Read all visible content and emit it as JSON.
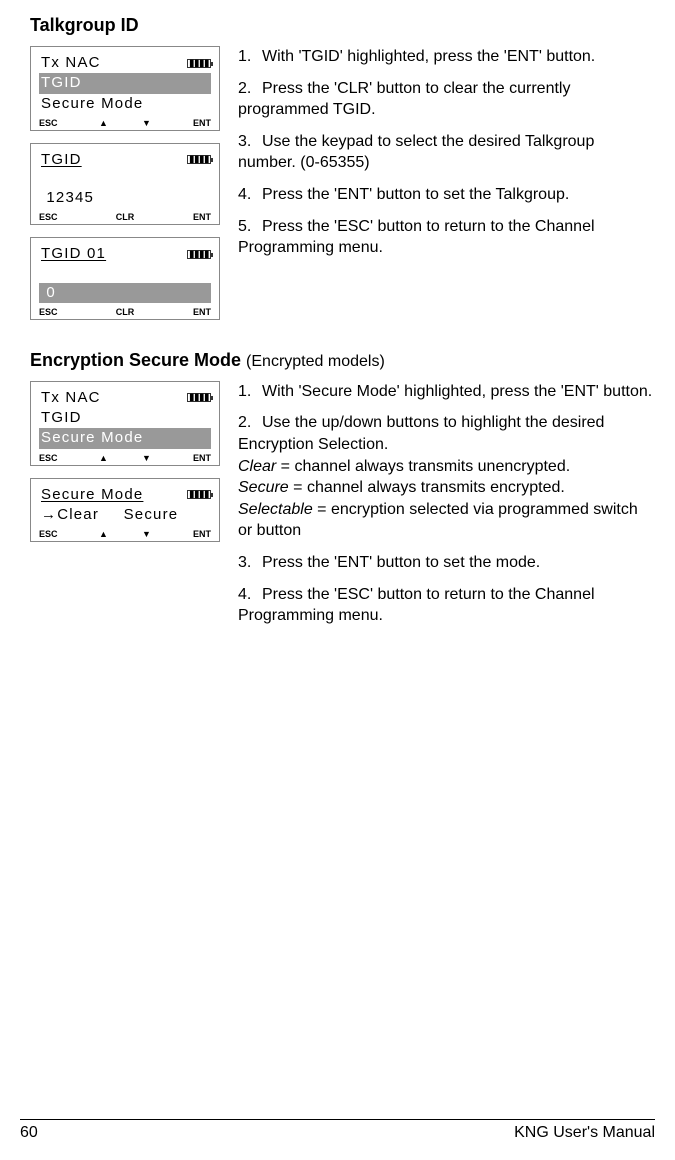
{
  "section1": {
    "heading": "Talkgroup ID",
    "screen1": {
      "line1": "Tx NAC",
      "line2": "TGID",
      "line3": "Secure Mode",
      "sk1": "ESC",
      "sk2": "▲",
      "sk3": "▼",
      "sk4": "ENT"
    },
    "screen2": {
      "line1": "TGID",
      "line2": " 12345",
      "sk1": "ESC",
      "sk2": "CLR",
      "sk3": "ENT"
    },
    "screen3": {
      "line1": "TGID 01",
      "line2": " 0",
      "sk1": "ESC",
      "sk2": "CLR",
      "sk3": "ENT"
    },
    "steps": {
      "s1": "With 'TGID' highlighted, press the 'ENT' button.",
      "s2": "Press the 'CLR' button to clear the currently programmed TGID.",
      "s3": "Use the keypad to select the desired Talkgroup number. (0-65355)",
      "s4": "Press the 'ENT' button to set the Talkgroup.",
      "s5": "Press the 'ESC' button to return to the Channel Programming menu."
    }
  },
  "section2": {
    "heading": "Encryption Secure Mode ",
    "subtitle": "(Encrypted models)",
    "screen1": {
      "line1": "Tx NAC",
      "line2": "TGID",
      "line3": "Secure Mode",
      "sk1": "ESC",
      "sk2": "▲",
      "sk3": "▼",
      "sk4": "ENT"
    },
    "screen2": {
      "line1": "Secure Mode",
      "line2": "→Clear",
      "line3": "   Secure",
      "sk1": "ESC",
      "sk2": "▲",
      "sk3": "▼",
      "sk4": "ENT"
    },
    "steps": {
      "s1": "With 'Secure Mode' highlighted, press the 'ENT' button.",
      "s2": "Use the up/down buttons to highlight the desired Encryption Selection.",
      "s2a_i": "Clear",
      "s2a_t": " = channel always transmits unencrypted.",
      "s2b_i": "Secure",
      "s2b_t": " = channel always transmits encrypted.",
      "s2c_i": "Selectable",
      "s2c_t": " = encryption selected via programmed switch or button",
      "s3": "Press the 'ENT' button to set the mode.",
      "s4": "Press the 'ESC' button to return to the Channel Programming menu."
    }
  },
  "footer": {
    "page": "60",
    "title": "KNG User's Manual"
  },
  "nums": {
    "n1": "1.",
    "n2": "2.",
    "n3": "3.",
    "n4": "4.",
    "n5": "5."
  },
  "battery": "▮▮▮▮"
}
